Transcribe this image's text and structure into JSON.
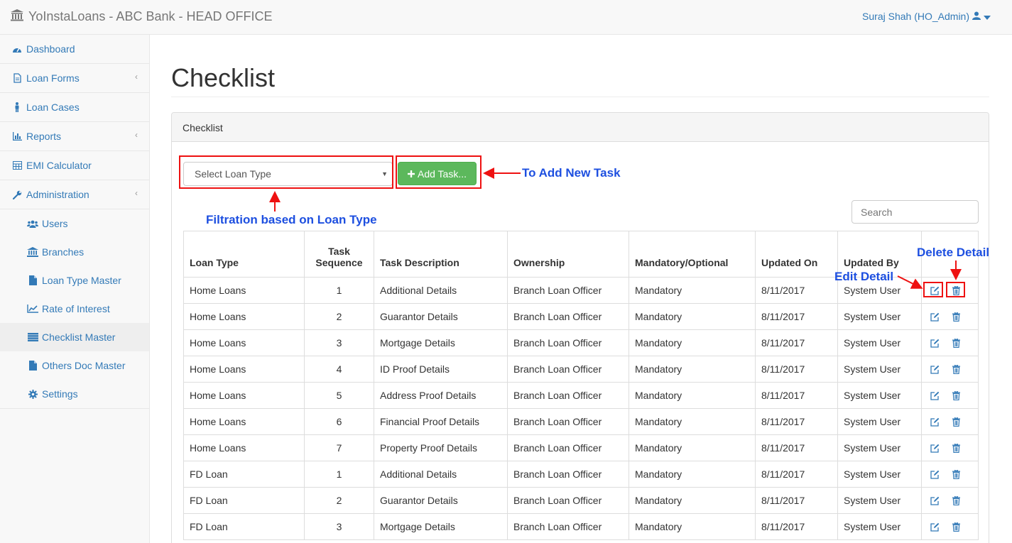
{
  "header": {
    "brand": "YoInstaLoans - ABC Bank - HEAD OFFICE",
    "user": "Suraj Shah (HO_Admin)"
  },
  "sidebar": {
    "items": [
      {
        "label": "Dashboard",
        "icon": "dashboard-icon"
      },
      {
        "label": "Loan Forms",
        "icon": "file-icon"
      },
      {
        "label": "Loan Cases",
        "icon": "person-icon"
      },
      {
        "label": "Reports",
        "icon": "bar-chart-icon"
      },
      {
        "label": "EMI Calculator",
        "icon": "calculator-icon"
      },
      {
        "label": "Administration",
        "icon": "wrench-icon"
      }
    ],
    "subitems": [
      {
        "label": "Users",
        "icon": "users-icon"
      },
      {
        "label": "Branches",
        "icon": "bank-icon"
      },
      {
        "label": "Loan Type Master",
        "icon": "file-icon"
      },
      {
        "label": "Rate of Interest",
        "icon": "line-chart-icon"
      },
      {
        "label": "Checklist Master",
        "icon": "list-icon"
      },
      {
        "label": "Others Doc Master",
        "icon": "file-icon"
      },
      {
        "label": "Settings",
        "icon": "gear-icon"
      }
    ]
  },
  "main": {
    "title": "Checklist",
    "panel_title": "Checklist",
    "select_placeholder": "Select Loan Type",
    "add_button": "Add Task...",
    "search_placeholder": "Search"
  },
  "annotations": {
    "add_task": "To Add New Task",
    "filter": "Filtration based on Loan Type",
    "delete": "Delete Detail",
    "edit": "Edit Detail"
  },
  "table": {
    "headers": {
      "loan_type": "Loan Type",
      "task_seq_1": "Task",
      "task_seq_2": "Sequence",
      "task_desc": "Task Description",
      "ownership": "Ownership",
      "mandatory": "Mandatory/Optional",
      "updated_on": "Updated On",
      "updated_by": "Updated By"
    },
    "rows": [
      {
        "loan_type": "Home Loans",
        "seq": "1",
        "desc": "Additional Details",
        "owner": "Branch Loan Officer",
        "mandatory": "Mandatory",
        "updated_on": "8/11/2017",
        "updated_by": "System User"
      },
      {
        "loan_type": "Home Loans",
        "seq": "2",
        "desc": "Guarantor Details",
        "owner": "Branch Loan Officer",
        "mandatory": "Mandatory",
        "updated_on": "8/11/2017",
        "updated_by": "System User"
      },
      {
        "loan_type": "Home Loans",
        "seq": "3",
        "desc": "Mortgage Details",
        "owner": "Branch Loan Officer",
        "mandatory": "Mandatory",
        "updated_on": "8/11/2017",
        "updated_by": "System User"
      },
      {
        "loan_type": "Home Loans",
        "seq": "4",
        "desc": "ID Proof Details",
        "owner": "Branch Loan Officer",
        "mandatory": "Mandatory",
        "updated_on": "8/11/2017",
        "updated_by": "System User"
      },
      {
        "loan_type": "Home Loans",
        "seq": "5",
        "desc": "Address Proof Details",
        "owner": "Branch Loan Officer",
        "mandatory": "Mandatory",
        "updated_on": "8/11/2017",
        "updated_by": "System User"
      },
      {
        "loan_type": "Home Loans",
        "seq": "6",
        "desc": "Financial Proof Details",
        "owner": "Branch Loan Officer",
        "mandatory": "Mandatory",
        "updated_on": "8/11/2017",
        "updated_by": "System User"
      },
      {
        "loan_type": "Home Loans",
        "seq": "7",
        "desc": "Property Proof Details",
        "owner": "Branch Loan Officer",
        "mandatory": "Mandatory",
        "updated_on": "8/11/2017",
        "updated_by": "System User"
      },
      {
        "loan_type": "FD Loan",
        "seq": "1",
        "desc": "Additional Details",
        "owner": "Branch Loan Officer",
        "mandatory": "Mandatory",
        "updated_on": "8/11/2017",
        "updated_by": "System User"
      },
      {
        "loan_type": "FD Loan",
        "seq": "2",
        "desc": "Guarantor Details",
        "owner": "Branch Loan Officer",
        "mandatory": "Mandatory",
        "updated_on": "8/11/2017",
        "updated_by": "System User"
      },
      {
        "loan_type": "FD Loan",
        "seq": "3",
        "desc": "Mortgage Details",
        "owner": "Branch Loan Officer",
        "mandatory": "Mandatory",
        "updated_on": "8/11/2017",
        "updated_by": "System User"
      }
    ]
  },
  "colors": {
    "link": "#337ab7",
    "success": "#5cb85c",
    "annotation_red": "#e11",
    "annotation_blue": "#1d4fe0"
  }
}
